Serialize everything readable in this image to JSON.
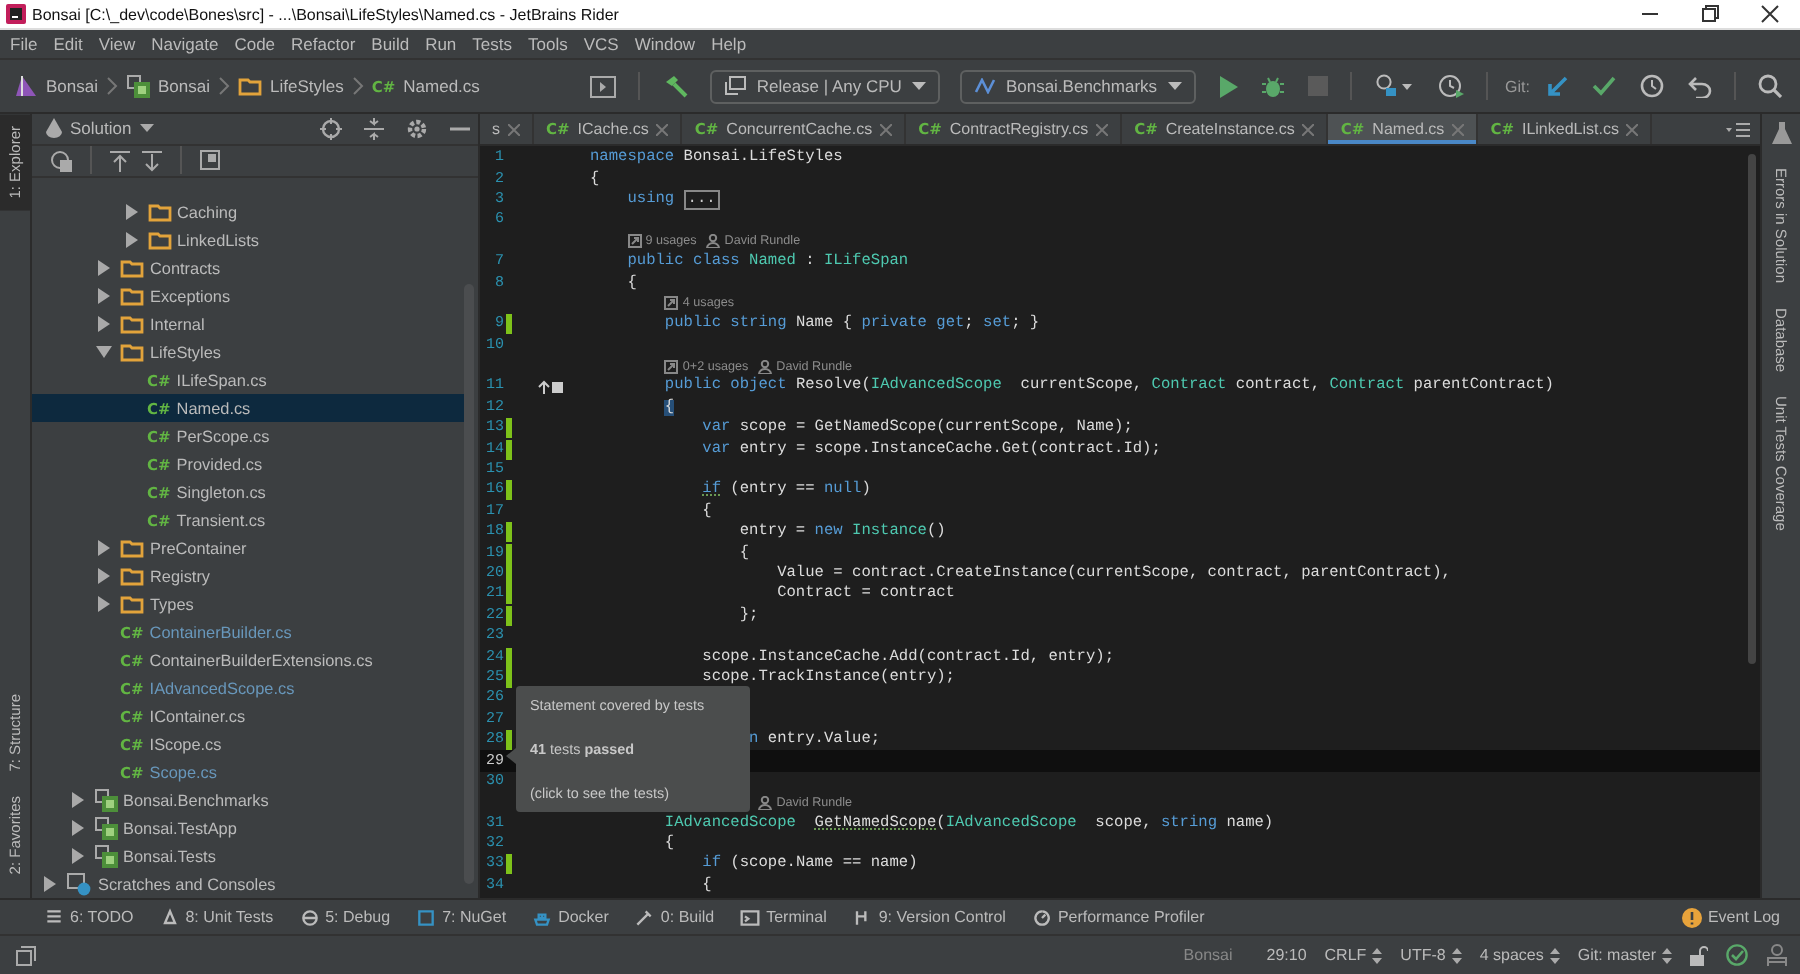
{
  "window": {
    "title": "Bonsai [C:\\_dev\\code\\Bones\\src] - ...\\Bonsai\\LifeStyles\\Named.cs - JetBrains Rider"
  },
  "menu": [
    "File",
    "Edit",
    "View",
    "Navigate",
    "Code",
    "Refactor",
    "Build",
    "Run",
    "Tests",
    "Tools",
    "VCS",
    "Window",
    "Help"
  ],
  "breadcrumbs": [
    {
      "kind": "solution",
      "label": "Bonsai"
    },
    {
      "kind": "project",
      "label": "Bonsai"
    },
    {
      "kind": "folder",
      "label": "LifeStyles"
    },
    {
      "kind": "file",
      "badge": "C#",
      "label": "Named.cs"
    }
  ],
  "run_config": {
    "label": "Release | Any CPU"
  },
  "startup_project": {
    "label": "Bonsai.Benchmarks"
  },
  "git_label": "Git:",
  "left_tool_tabs": {
    "top": [
      {
        "label": "1: Explorer",
        "selected": true
      }
    ],
    "bottom": [
      {
        "label": "7: Structure",
        "selected": false
      },
      {
        "label": "2: Favorites",
        "selected": false
      }
    ]
  },
  "explorer": {
    "view": "Solution",
    "tree": [
      {
        "children": [
          {
            "children": [
              {
                "children": [
                  {
                    "label": "Caching",
                    "kind": "folder",
                    "expanded": false,
                    "selected": false
                  },
                  {
                    "label": "LinkedLists",
                    "kind": "folder",
                    "expanded": false,
                    "selected": false
                  }
                ]
              },
              {
                "label": "Contracts",
                "kind": "folder",
                "expanded": false,
                "selected": false
              },
              {
                "label": "Exceptions",
                "kind": "folder",
                "expanded": false,
                "selected": false
              },
              {
                "label": "Internal",
                "kind": "folder",
                "expanded": false,
                "selected": false
              },
              {
                "label": "LifeStyles",
                "kind": "folder",
                "expanded": true,
                "selected": false,
                "children": [
                  {
                    "label": "ILifeSpan.cs",
                    "kind": "file",
                    "badge": "C#",
                    "modified": false,
                    "selected": false
                  },
                  {
                    "label": "Named.cs",
                    "kind": "file",
                    "badge": "C#",
                    "modified": false,
                    "selected": true
                  },
                  {
                    "label": "PerScope.cs",
                    "kind": "file",
                    "badge": "C#",
                    "modified": false,
                    "selected": false
                  },
                  {
                    "label": "Provided.cs",
                    "kind": "file",
                    "badge": "C#",
                    "modified": false,
                    "selected": false
                  },
                  {
                    "label": "Singleton.cs",
                    "kind": "file",
                    "badge": "C#",
                    "modified": false,
                    "selected": false
                  },
                  {
                    "label": "Transient.cs",
                    "kind": "file",
                    "badge": "C#",
                    "modified": false,
                    "selected": false
                  }
                ]
              },
              {
                "label": "PreContainer",
                "kind": "folder",
                "expanded": false,
                "selected": false
              },
              {
                "label": "Registry",
                "kind": "folder",
                "expanded": false,
                "selected": false
              },
              {
                "label": "Types",
                "kind": "folder",
                "expanded": false,
                "selected": false
              },
              {
                "label": "ContainerBuilder.cs",
                "kind": "file",
                "badge": "C#",
                "modified": true,
                "selected": false
              },
              {
                "label": "ContainerBuilderExtensions.cs",
                "kind": "file",
                "badge": "C#",
                "modified": false,
                "selected": false
              },
              {
                "label": "IAdvancedScope.cs",
                "kind": "file",
                "badge": "C#",
                "modified": true,
                "selected": false
              },
              {
                "label": "IContainer.cs",
                "kind": "file",
                "badge": "C#",
                "modified": false,
                "selected": false
              },
              {
                "label": "IScope.cs",
                "kind": "file",
                "badge": "C#",
                "modified": false,
                "selected": false
              },
              {
                "label": "Scope.cs",
                "kind": "file",
                "badge": "C#",
                "modified": true,
                "selected": false
              }
            ]
          },
          {
            "label": "Bonsai.Benchmarks",
            "kind": "project",
            "expanded": false,
            "selected": false
          },
          {
            "label": "Bonsai.TestApp",
            "kind": "project",
            "expanded": false,
            "selected": false
          },
          {
            "label": "Bonsai.Tests",
            "kind": "project",
            "expanded": false,
            "selected": false
          }
        ]
      },
      {
        "label": "Scratches and Consoles",
        "kind": "scratches",
        "expanded": false,
        "selected": false
      }
    ]
  },
  "tabs": [
    {
      "label": "s",
      "selected": false
    },
    {
      "badge": "C#",
      "label": "ICache.cs",
      "selected": false
    },
    {
      "badge": "C#",
      "label": "ConcurrentCache.cs",
      "selected": false
    },
    {
      "badge": "C#",
      "label": "ContractRegistry.cs",
      "selected": false
    },
    {
      "badge": "C#",
      "label": "CreateInstance.cs",
      "selected": false
    },
    {
      "badge": "C#",
      "label": "Named.cs",
      "selected": true
    },
    {
      "badge": "C#",
      "label": "ILinkedList.cs",
      "selected": false
    }
  ],
  "lines": [
    {
      "kind": "code",
      "number": "1",
      "covered": false,
      "tokens": [
        {
          "kind": "keyword",
          "text": "namespace"
        },
        {
          "kind": "plain",
          "text": " Bonsai.LifeStyles"
        }
      ]
    },
    {
      "kind": "code",
      "number": "2",
      "covered": false,
      "tokens": [
        {
          "kind": "plain",
          "text": "{"
        }
      ]
    },
    {
      "kind": "code",
      "number": "3",
      "covered": false,
      "tokens": [
        {
          "kind": "keyword",
          "text": "    using"
        },
        {
          "kind": "fold",
          "text": "..."
        }
      ]
    },
    {
      "kind": "code",
      "number": "6",
      "covered": false
    },
    {
      "kind": "lens",
      "usages": "9 usages",
      "author": "David Rundle"
    },
    {
      "kind": "code",
      "number": "7",
      "covered": false,
      "tokens": [
        {
          "kind": "keyword",
          "text": "    public class"
        },
        {
          "kind": "type",
          "text": " Named"
        },
        {
          "kind": "plain",
          "text": " : "
        },
        {
          "kind": "type",
          "text": "ILifeSpan"
        }
      ]
    },
    {
      "kind": "code",
      "number": "8",
      "covered": false,
      "tokens": [
        {
          "kind": "plain",
          "text": "    {"
        }
      ]
    },
    {
      "kind": "lens",
      "usages": "4 usages"
    },
    {
      "kind": "code",
      "number": "9",
      "covered": true,
      "tokens": [
        {
          "kind": "keyword",
          "text": "        public string"
        },
        {
          "kind": "plain",
          "text": " Name { "
        },
        {
          "kind": "keyword",
          "text": "private get"
        },
        {
          "kind": "plain",
          "text": "; "
        },
        {
          "kind": "keyword",
          "text": "set"
        },
        {
          "kind": "plain",
          "text": "; }"
        }
      ]
    },
    {
      "kind": "code",
      "number": "10",
      "covered": false
    },
    {
      "kind": "lens",
      "usages": "0+2 usages",
      "author": "David Rundle"
    },
    {
      "kind": "code",
      "number": "11",
      "covered": false,
      "implements": true,
      "tokens": [
        {
          "kind": "keyword",
          "text": "        public object"
        },
        {
          "kind": "plain",
          "text": " Resolve("
        },
        {
          "kind": "type",
          "text": "IAdvancedScope"
        },
        {
          "kind": "plain",
          "text": "  currentScope, "
        },
        {
          "kind": "type",
          "text": "Contract"
        },
        {
          "kind": "plain",
          "text": " contract, "
        },
        {
          "kind": "type",
          "text": "Contract"
        },
        {
          "kind": "plain",
          "text": " parentContract)"
        }
      ]
    },
    {
      "kind": "code",
      "number": "12",
      "covered": false,
      "tokens": [
        {
          "kind": "brace",
          "text": "{"
        }
      ]
    },
    {
      "kind": "code",
      "number": "13",
      "covered": true,
      "tokens": [
        {
          "kind": "keyword",
          "text": "            var"
        },
        {
          "kind": "plain",
          "text": " scope = GetNamedScope(currentScope, Name);"
        }
      ]
    },
    {
      "kind": "code",
      "number": "14",
      "covered": true,
      "tokens": [
        {
          "kind": "keyword",
          "text": "            var"
        },
        {
          "kind": "plain",
          "text": " entry = scope.InstanceCache.Get(contract.Id);"
        }
      ]
    },
    {
      "kind": "code",
      "number": "15",
      "covered": false
    },
    {
      "kind": "code",
      "number": "16",
      "covered": true,
      "tokens": [
        {
          "kind": "hinted_keyword",
          "text": "if"
        },
        {
          "kind": "plain",
          "text": " (entry == "
        },
        {
          "kind": "keyword",
          "text": "null"
        },
        {
          "kind": "plain",
          "text": ")"
        }
      ]
    },
    {
      "kind": "code",
      "number": "17",
      "covered": false,
      "tokens": [
        {
          "kind": "plain",
          "text": "            {"
        }
      ]
    },
    {
      "kind": "code",
      "number": "18",
      "covered": true,
      "tokens": [
        {
          "kind": "plain",
          "text": "                entry = "
        },
        {
          "kind": "keyword",
          "text": "new"
        },
        {
          "kind": "type",
          "text": " Instance"
        },
        {
          "kind": "plain",
          "text": "()"
        }
      ]
    },
    {
      "kind": "code",
      "number": "19",
      "covered": true,
      "tokens": [
        {
          "kind": "plain",
          "text": "                {"
        }
      ]
    },
    {
      "kind": "code",
      "number": "20",
      "covered": true,
      "tokens": [
        {
          "kind": "plain",
          "text": "                    Value = contract.CreateInstance(currentScope, contract, parentContract),"
        }
      ]
    },
    {
      "kind": "code",
      "number": "21",
      "covered": true,
      "tokens": [
        {
          "kind": "plain",
          "text": "                    Contract = contract"
        }
      ]
    },
    {
      "kind": "code",
      "number": "22",
      "covered": true,
      "tokens": [
        {
          "kind": "plain",
          "text": "                };"
        }
      ]
    },
    {
      "kind": "code",
      "number": "23",
      "covered": false
    },
    {
      "kind": "code",
      "number": "24",
      "covered": true,
      "tokens": [
        {
          "kind": "plain",
          "text": "            scope.InstanceCache.Add(contract.Id, entry);"
        }
      ]
    },
    {
      "kind": "code",
      "number": "25",
      "covered": true,
      "tokens": [
        {
          "kind": "plain",
          "text": "            scope.TrackInstance(entry);"
        }
      ]
    },
    {
      "kind": "code",
      "number": "26",
      "covered": false
    },
    {
      "kind": "code",
      "number": "27",
      "covered": false
    },
    {
      "kind": "code",
      "number": "28",
      "covered": true,
      "tokens": [
        {
          "kind": "keyword",
          "text": "                 n"
        },
        {
          "kind": "plain",
          "text": " entry.Value;"
        }
      ]
    },
    {
      "kind": "code",
      "number": "29",
      "covered": false,
      "current": true
    },
    {
      "kind": "code",
      "number": "30",
      "covered": false
    },
    {
      "kind": "lens",
      "author": "David Rundle"
    },
    {
      "kind": "code",
      "number": "31",
      "covered": false,
      "tokens": [
        {
          "kind": "type",
          "text": "        IAdvancedScope  "
        },
        {
          "kind": "hinted",
          "text": "GetNamedScope"
        },
        {
          "kind": "plain",
          "text": "("
        },
        {
          "kind": "type",
          "text": "IAdvancedScope"
        },
        {
          "kind": "plain",
          "text": "  scope, "
        },
        {
          "kind": "keyword",
          "text": "string"
        },
        {
          "kind": "plain",
          "text": " name)"
        }
      ]
    },
    {
      "kind": "code",
      "number": "32",
      "covered": false,
      "tokens": [
        {
          "kind": "plain",
          "text": "        {"
        }
      ]
    },
    {
      "kind": "code",
      "number": "33",
      "covered": true,
      "tokens": [
        {
          "kind": "keyword",
          "text": "            if"
        },
        {
          "kind": "plain",
          "text": " (scope.Name == name)"
        }
      ]
    },
    {
      "kind": "code",
      "number": "34",
      "covered": false,
      "tokens": [
        {
          "kind": "plain",
          "text": "            {"
        }
      ]
    }
  ],
  "tooltip": {
    "title": "Statement covered by tests",
    "result": "**41** tests **passed**",
    "hint": "(click to see the tests)"
  },
  "right_tool_tabs": [
    "Errors in Solution",
    "Database",
    "Unit Tests Coverage"
  ],
  "tool_windows": [
    "6: TODO",
    "8: Unit Tests",
    "5: Debug",
    "7: NuGet",
    "Docker",
    "0: Build",
    "Terminal",
    "9: Version Control",
    "Performance Profiler"
  ],
  "event_log": "Event Log",
  "status": {
    "project": "Bonsai",
    "position": "29:10",
    "line_ending": "CRLF",
    "encoding": "UTF-8",
    "indent": "4 spaces",
    "branch": "Git: master"
  }
}
